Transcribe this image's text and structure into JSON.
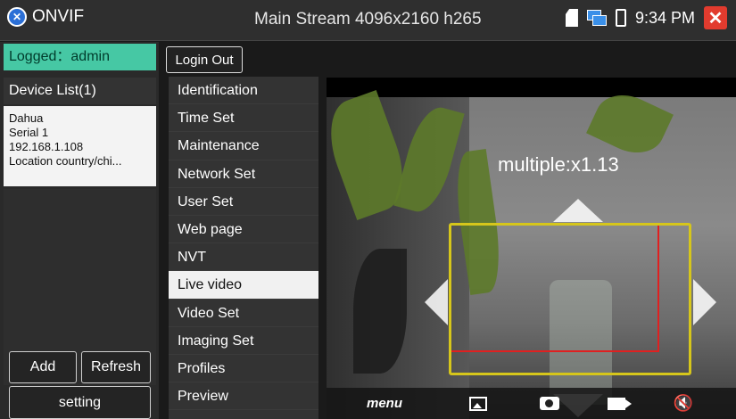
{
  "titlebar": {
    "app_name": "ONVIF",
    "logo_glyph": "✕",
    "stream_title": "Main Stream 4096x2160 h265",
    "time": "9:34 PM",
    "icons": [
      "sd-card-icon",
      "network-icon",
      "battery-icon",
      "close-icon"
    ],
    "close_glyph": "✕"
  },
  "sidebar": {
    "logged_in": "Logged：admin",
    "device_list_header": "Device List(1)",
    "device": {
      "name": "Dahua",
      "serial": "Serial 1",
      "ip": "192.168.1.108",
      "location": "Location country/chi..."
    },
    "add_label": "Add",
    "refresh_label": "Refresh",
    "setting_label": "setting"
  },
  "login_out_label": "Login Out",
  "menu": {
    "items": [
      "Identification",
      "Time Set",
      "Maintenance",
      "Network Set",
      "User Set",
      "Web page",
      "NVT",
      "Live video",
      "Video Set",
      "Imaging Set",
      "Profiles",
      "Preview"
    ],
    "active": "Live video"
  },
  "video": {
    "zoom_text": "multiple:x1.13"
  },
  "toolbar": {
    "menu_label": "menu",
    "icons": [
      "picture-icon",
      "camera-icon",
      "record-icon",
      "mute-icon"
    ]
  },
  "colors": {
    "accent": "#46c8a4",
    "zoom_box": "#d6c61b",
    "close": "#e23b2e",
    "red_box": "#e02020"
  }
}
